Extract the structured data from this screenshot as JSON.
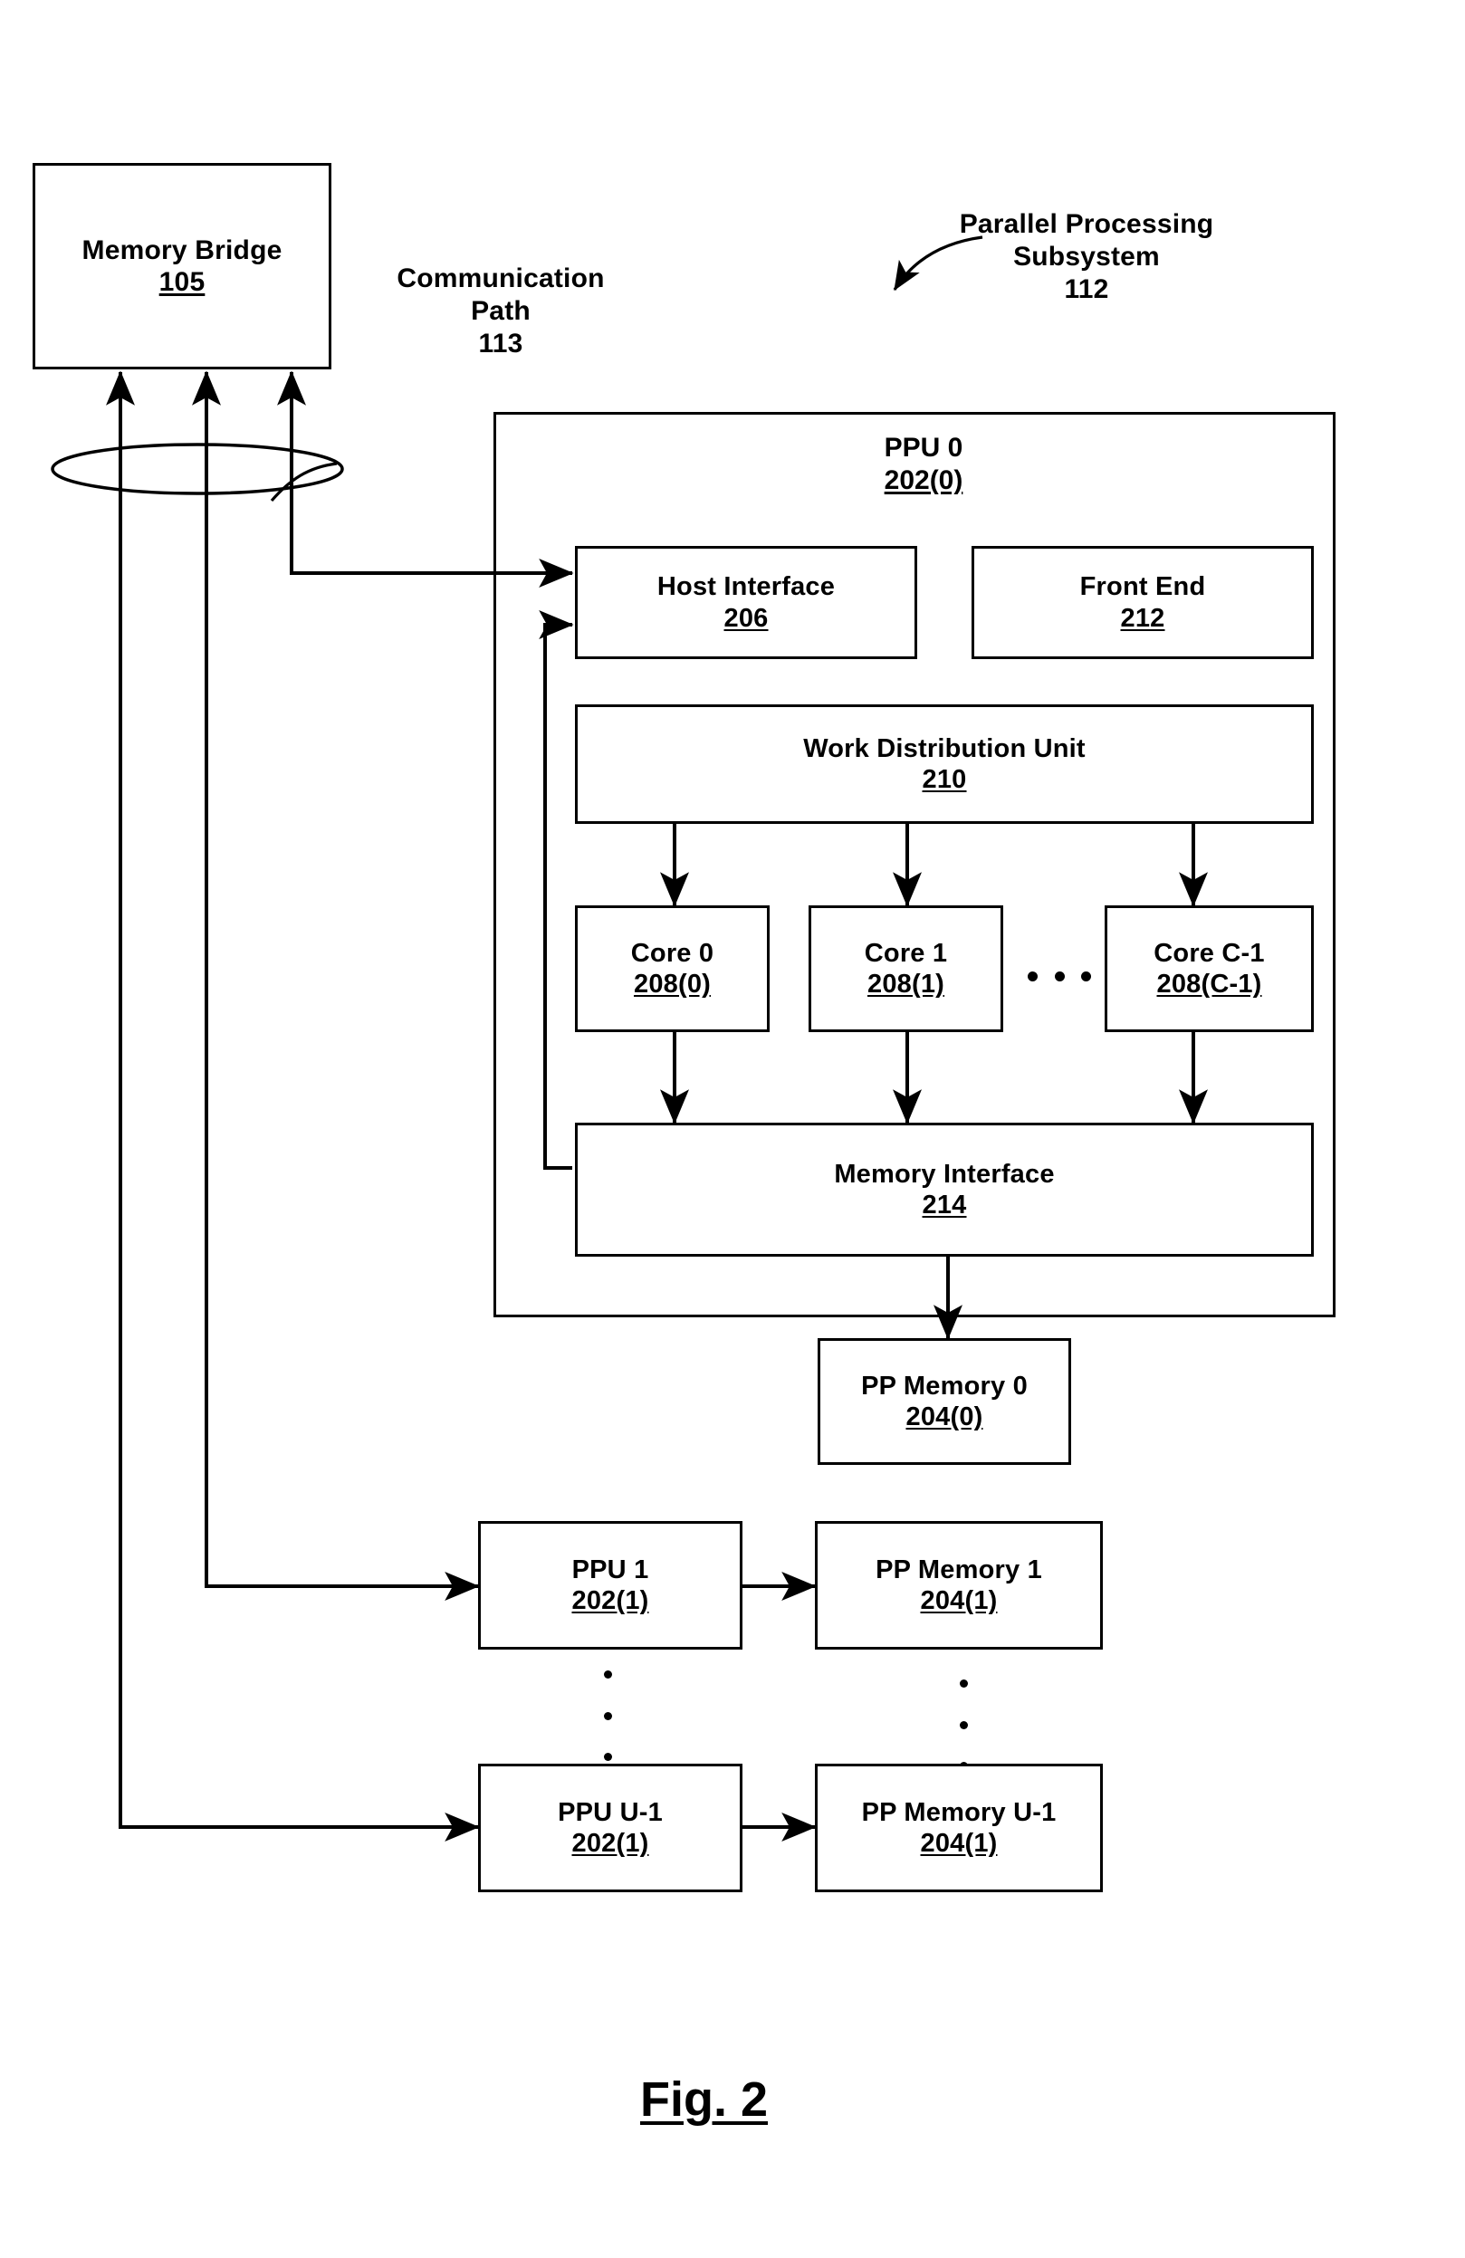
{
  "figure": {
    "caption": "Fig. 2"
  },
  "labels": {
    "communication_path": "Communication\nPath\n113",
    "parallel_processing_subsystem": "Parallel Processing\nSubsystem\n112",
    "ppu0_title": "PPU 0",
    "ppu0_num": "202(0)"
  },
  "blocks": {
    "memory_bridge": {
      "title": "Memory Bridge",
      "num": "105"
    },
    "host_interface": {
      "title": "Host Interface",
      "num": "206"
    },
    "front_end": {
      "title": "Front End",
      "num": "212"
    },
    "work_distribution_unit": {
      "title": "Work Distribution Unit",
      "num": "210"
    },
    "core_0": {
      "title": "Core 0",
      "num": "208(0)"
    },
    "core_1": {
      "title": "Core 1",
      "num": "208(1)"
    },
    "core_c1": {
      "title": "Core C-1",
      "num": "208(C-1)"
    },
    "memory_interface": {
      "title": "Memory Interface",
      "num": "214"
    },
    "pp_memory_0": {
      "title": "PP Memory 0",
      "num": "204(0)"
    },
    "ppu_1": {
      "title": "PPU 1",
      "num": "202(1)"
    },
    "pp_memory_1": {
      "title": "PP Memory 1",
      "num": "204(1)"
    },
    "ppu_u1": {
      "title": "PPU U-1",
      "num": "202(1)"
    },
    "pp_memory_u1": {
      "title": "PP Memory U-1",
      "num": "204(1)"
    }
  },
  "colors": {
    "stroke": "#000000",
    "background": "#ffffff"
  }
}
